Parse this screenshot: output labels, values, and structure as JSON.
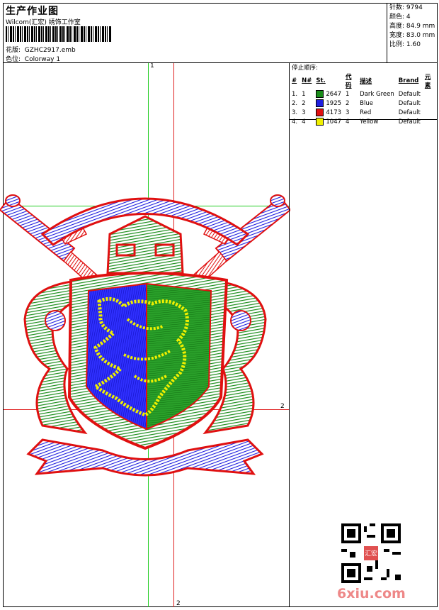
{
  "header": {
    "title": "生产作业图",
    "company": "Wilcom(汇宏) 绣饰工作室",
    "pattern_label": "花版:",
    "pattern_value": "GZHC2917.emb",
    "colorway_label": "色位:",
    "colorway_value": "Colorway 1"
  },
  "stats": {
    "stitches": "针数: 9794",
    "colors": "颜色: 4",
    "height": "高度: 84.9 mm",
    "width": "宽度: 83.0 mm",
    "scale": "比例: 1.60"
  },
  "axes": {
    "v1": "1",
    "v2": "2",
    "h2": "2"
  },
  "stop_sequence": {
    "title": "停止顺序:",
    "headers": [
      "#",
      "N#",
      "St.",
      "代码",
      "描述",
      "Brand",
      "元素"
    ],
    "rows": [
      {
        "num": "1.",
        "n": "1",
        "stitches": "2647",
        "code": "1",
        "desc": "Dark Green",
        "brand": "Default",
        "color": "#1a8c1a"
      },
      {
        "num": "2.",
        "n": "2",
        "stitches": "1925",
        "code": "2",
        "desc": "Blue",
        "brand": "Default",
        "color": "#1f1fe0"
      },
      {
        "num": "3.",
        "n": "3",
        "stitches": "4173",
        "code": "3",
        "desc": "Red",
        "brand": "Default",
        "color": "#e01010"
      },
      {
        "num": "4.",
        "n": "4",
        "stitches": "1047",
        "code": "4",
        "desc": "Yellow",
        "brand": "Default",
        "color": "#f0f000"
      }
    ]
  },
  "watermark": "6xiu.com",
  "seal_text": "汇宏"
}
